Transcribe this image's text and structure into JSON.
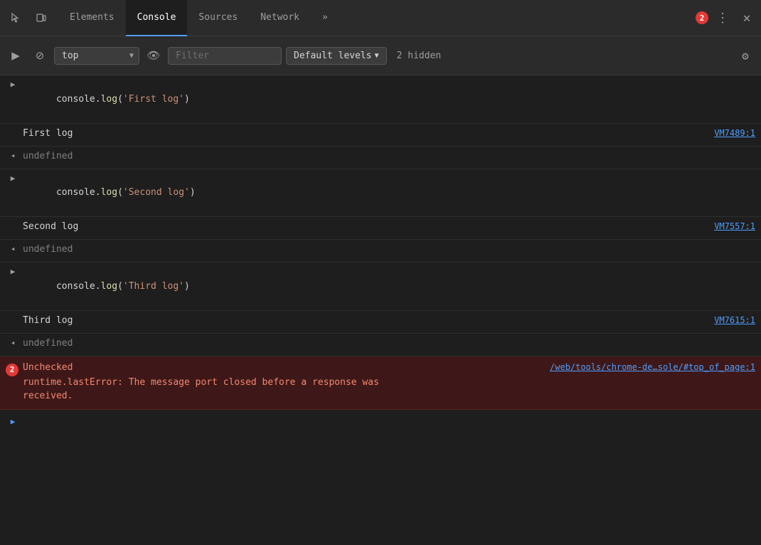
{
  "tabbar": {
    "tabs": [
      {
        "id": "elements",
        "label": "Elements",
        "active": false
      },
      {
        "id": "console",
        "label": "Console",
        "active": true
      },
      {
        "id": "sources",
        "label": "Sources",
        "active": false
      },
      {
        "id": "network",
        "label": "Network",
        "active": false
      },
      {
        "id": "more",
        "label": "»",
        "active": false
      }
    ],
    "error_count": "2",
    "more_label": "⋮",
    "close_label": "✕"
  },
  "toolbar": {
    "context_value": "top",
    "filter_placeholder": "Filter",
    "levels_label": "Default levels",
    "hidden_label": "2 hidden",
    "eye_icon": "👁",
    "play_icon": "▶",
    "ban_icon": "⊘"
  },
  "console_rows": [
    {
      "type": "input",
      "expand": true,
      "code": "console.log('First log')"
    },
    {
      "type": "output",
      "text": "First log",
      "source": "VM7489:1"
    },
    {
      "type": "undefined",
      "text": "undefined"
    },
    {
      "type": "input",
      "expand": true,
      "code": "console.log('Second log')"
    },
    {
      "type": "output",
      "text": "Second log",
      "source": "VM7557:1"
    },
    {
      "type": "undefined",
      "text": "undefined"
    },
    {
      "type": "input",
      "expand": true,
      "code": "console.log('Third log')"
    },
    {
      "type": "output",
      "text": "Third log",
      "source": "VM7615:1"
    },
    {
      "type": "undefined",
      "text": "undefined"
    },
    {
      "type": "error",
      "badge": "2",
      "title": "Unchecked",
      "source": "/web/tools/chrome-de…sole/#top_of_page:1",
      "message": "runtime.lastError: The message port closed before a response was\nreceived."
    }
  ],
  "input_prompt": ">"
}
